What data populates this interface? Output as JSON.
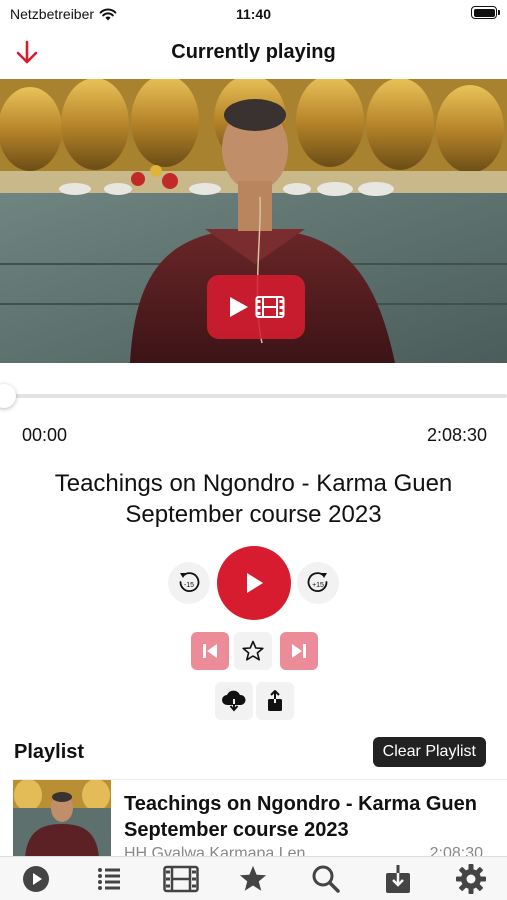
{
  "status_bar": {
    "carrier": "Netzbetreiber",
    "time": "11:40"
  },
  "nav": {
    "title": "Currently playing",
    "back_icon": "arrow-down-icon"
  },
  "video": {
    "overlay_icon": "play-film-icon"
  },
  "player": {
    "elapsed": "00:00",
    "total": "2:08:30",
    "progress": 0,
    "title": "Teachings on Ngondro - Karma Guen September course 2023",
    "rewind_icon": "rewind-15-icon",
    "forward_icon": "forward-15-icon",
    "play_icon": "play-icon",
    "prev_icon": "skip-previous-icon",
    "next_icon": "skip-next-icon",
    "favorite_icon": "star-icon",
    "download_icon": "cloud-download-icon",
    "share_icon": "share-icon"
  },
  "playlist": {
    "header": "Playlist",
    "clear_label": "Clear Playlist",
    "items": [
      {
        "title": "Teachings on Ngondro - Karma Guen September course 2023",
        "artist": "HH Gyalwa Karmapa Len...",
        "duration": "2:08:30"
      }
    ]
  },
  "tabbar": {
    "tabs": [
      "play-circle-icon",
      "list-icon",
      "film-icon",
      "star-icon",
      "search-icon",
      "download-icon",
      "gear-icon"
    ]
  },
  "colors": {
    "accent": "#d71c30",
    "accent_light": "#eb8c98",
    "dark_button": "#222222"
  }
}
